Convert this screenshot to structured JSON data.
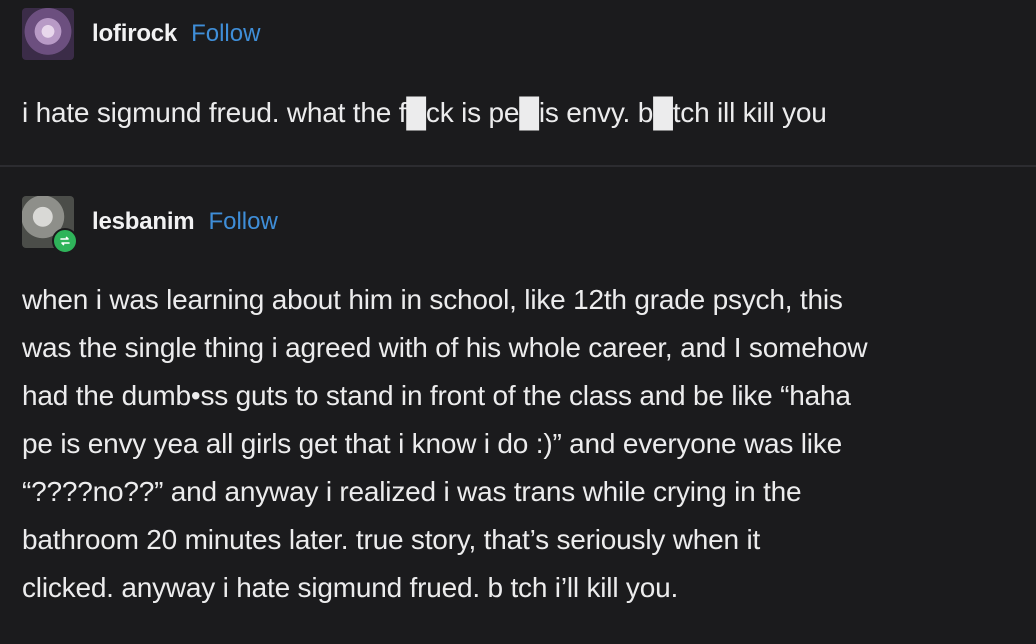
{
  "posts": [
    {
      "username": "lofirock",
      "follow_label": "Follow",
      "avatar_icon": "user-avatar-icon",
      "lines": [
        "i hate sigmund freud. what the f█ck is pe█is envy. b█tch ill kill you"
      ]
    },
    {
      "username": "lesbanim",
      "follow_label": "Follow",
      "avatar_icon": "user-avatar-icon",
      "reblog_icon": "reblog-icon",
      "reblog_color": "#2fb45a",
      "lines": [
        "when i was learning about him in school, like 12th grade psych, this",
        "was the single thing i agreed with of his whole career, and I somehow",
        "had the dumb•ss guts to stand in front of the class and be like “haha",
        "pe  is envy yea all girls get that i know i do :)” and everyone was like",
        "“????no??” and anyway i realized i was trans while crying in the",
        "bathroom 20 minutes later. true story, that’s seriously when it",
        "clicked. anyway i hate sigmund frued. b tch i’ll kill you."
      ]
    }
  ],
  "colors": {
    "background": "#1b1b1d",
    "text": "#ececed",
    "follow": "#3f8ed8"
  }
}
